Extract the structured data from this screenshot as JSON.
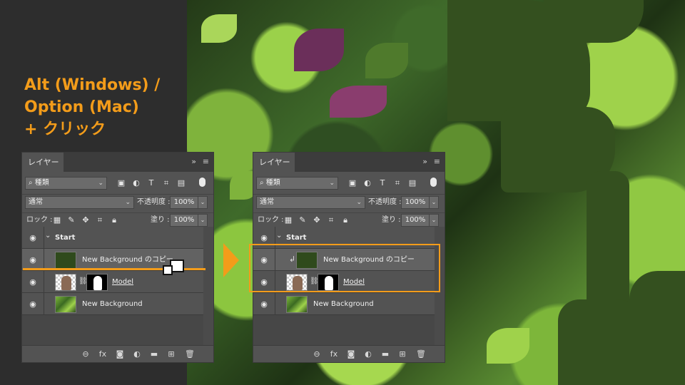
{
  "headline": {
    "line1": "Alt (Windows) /",
    "line2": "Option (Mac)",
    "line3": "+ クリック"
  },
  "colors": {
    "accent": "#f39c1a",
    "panel": "#535353",
    "silhouette": "#34501f"
  },
  "panels": [
    {
      "tab_label": "レイヤー",
      "filter_label": "種類",
      "filter_icons": [
        "image-filter-icon",
        "adjustment-filter-icon",
        "type-filter-icon",
        "shape-filter-icon",
        "smartobject-filter-icon"
      ],
      "blend_mode": "通常",
      "opacity_label": "不透明度 :",
      "opacity_value": "100%",
      "lock_label": "ロック :",
      "fill_label": "塗り :",
      "fill_value": "100%",
      "group_name": "Start",
      "layers": [
        {
          "name": "New Background のコピー"
        },
        {
          "name": "Model"
        },
        {
          "name": "New Background"
        }
      ]
    },
    {
      "tab_label": "レイヤー",
      "filter_label": "種類",
      "filter_icons": [
        "image-filter-icon",
        "adjustment-filter-icon",
        "type-filter-icon",
        "shape-filter-icon",
        "smartobject-filter-icon"
      ],
      "blend_mode": "通常",
      "opacity_label": "不透明度 :",
      "opacity_value": "100%",
      "lock_label": "ロック :",
      "fill_label": "塗り :",
      "fill_value": "100%",
      "group_name": "Start",
      "layers": [
        {
          "name": "New Background のコピー"
        },
        {
          "name": "Model"
        },
        {
          "name": "New Background"
        }
      ]
    }
  ]
}
